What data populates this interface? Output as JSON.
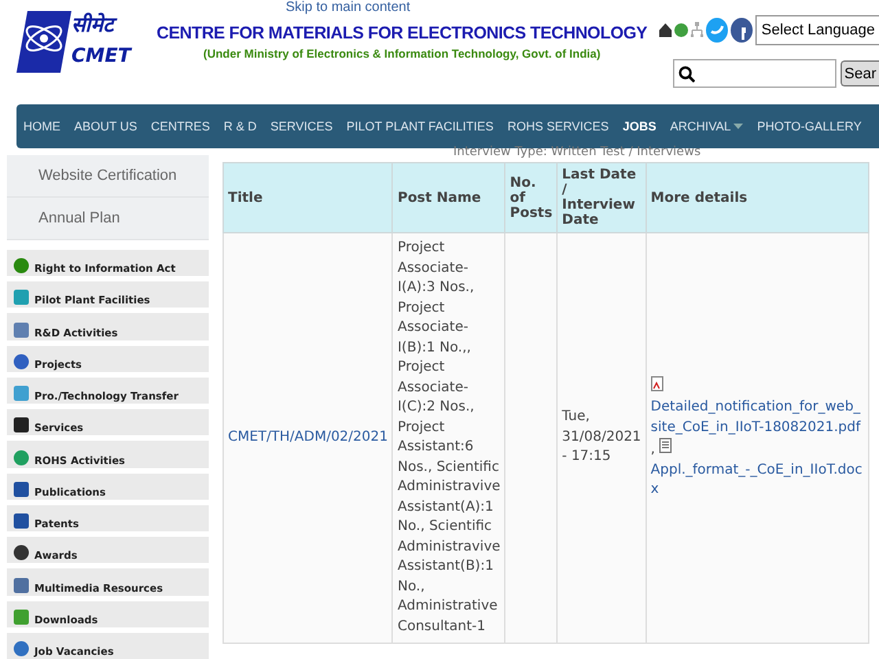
{
  "skip_link": "Skip to main content",
  "header": {
    "logo_text": "सीमेट",
    "logo_sub": "CMET",
    "title": "CENTRE FOR MATERIALS FOR ELECTRONICS TECHNOLOGY",
    "subtitle": "(Under Ministry of Electronics & Information Technology, Govt. of India)",
    "language_select": "Select Language",
    "search": {
      "button": "Sear"
    }
  },
  "nav": [
    {
      "label": "HOME",
      "selected": false,
      "dropdown": false
    },
    {
      "label": "ABOUT US",
      "selected": false,
      "dropdown": false
    },
    {
      "label": "CENTRES",
      "selected": false,
      "dropdown": false
    },
    {
      "label": "R & D",
      "selected": false,
      "dropdown": false
    },
    {
      "label": "SERVICES",
      "selected": false,
      "dropdown": false
    },
    {
      "label": "PILOT PLANT FACILITIES",
      "selected": false,
      "dropdown": false
    },
    {
      "label": "ROHS SERVICES",
      "selected": false,
      "dropdown": false
    },
    {
      "label": "JOBS",
      "selected": true,
      "dropdown": false
    },
    {
      "label": "ARCHIVAL",
      "selected": false,
      "dropdown": true
    },
    {
      "label": "PHOTO-GALLERY",
      "selected": false,
      "dropdown": false
    }
  ],
  "sidebar": {
    "top_links": [
      "Website Certification",
      "Annual Plan"
    ],
    "items": [
      "Right to Information Act",
      "Pilot Plant Facilities",
      "R&D Activities",
      "Projects",
      "Pro./Technology Transfer",
      "Services",
      "ROHS Activities",
      "Publications",
      "Patents",
      "Awards",
      "Multimedia Resources",
      "Downloads",
      "Job Vacancies"
    ]
  },
  "caption": "Interview Type: Written Test / Interviews",
  "table": {
    "columns": [
      "Title",
      "Post Name",
      "No. of Posts",
      "Last Date / Interview Date",
      "More details"
    ],
    "rows": [
      {
        "title": "CMET/TH/ADM/02/2021",
        "post_name": "Project Associate-I(A):3 Nos., Project Associate-I(B):1 No.,, Project Associate-I(C):2 Nos., Project Assistant:6 Nos., Scientific Administravive Assistant(A):1 No., Scientific Administravive Assistant(B):1 No., Administrative Consultant-1",
        "posts": "",
        "date": "Tue, 31/08/2021 - 17:15",
        "files": [
          {
            "kind": "pdf",
            "name": "Detailed_notification_for_web_site_CoE_in_IIoT-18082021.pdf",
            "sep": ","
          },
          {
            "kind": "doc",
            "name": "Appl._format_-_CoE_in_IIoT.docx"
          }
        ]
      }
    ]
  }
}
